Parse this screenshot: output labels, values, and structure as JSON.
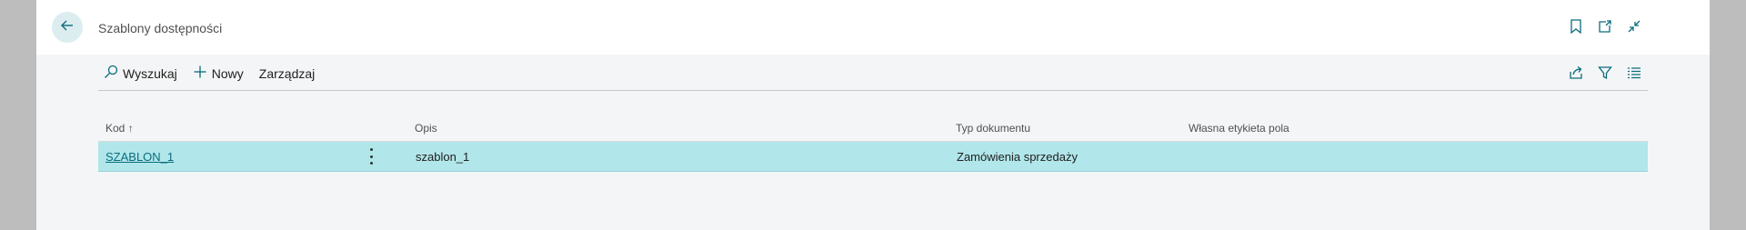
{
  "header": {
    "title": "Szablony dostępności",
    "back_icon": "arrow-left-icon",
    "actions": [
      "bookmark-icon",
      "open-in-new-window-icon",
      "collapse-icon"
    ]
  },
  "toolbar": {
    "search_label": "Wyszukaj",
    "new_label": "Nowy",
    "manage_label": "Zarządzaj",
    "right_icons": [
      "share-icon",
      "filter-icon",
      "list-view-icon"
    ]
  },
  "grid": {
    "columns": {
      "kod": "Kod",
      "sort_indicator": "↑",
      "opis": "Opis",
      "typ": "Typ dokumentu",
      "etykieta": "Własna etykieta pola"
    },
    "rows": [
      {
        "kod": "SZABLON_1",
        "opis": "szablon_1",
        "typ": "Zamówienia sprzedaży",
        "etykieta": ""
      }
    ]
  },
  "colors": {
    "accent": "#0a6d7c",
    "row_selected": "#b1e6ea",
    "back_button_bg": "#dcedf0",
    "page_bg": "#f4f5f6",
    "outside_bg": "#bdbdbd"
  }
}
